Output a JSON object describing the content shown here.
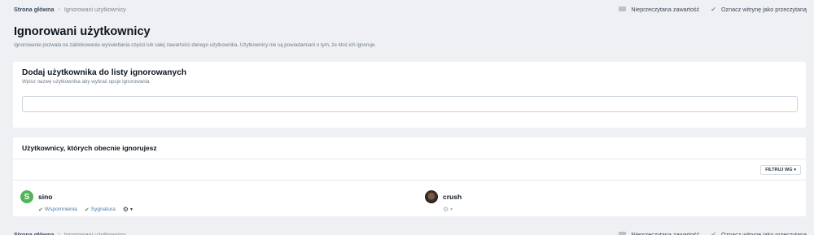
{
  "breadcrumb": {
    "home": "Strona główna",
    "separator": "›",
    "current": "Ignorowani użytkownicy"
  },
  "topbar_actions": {
    "unread": "Nieprzeczytana zawartość",
    "mark_read": "Oznacz witrynę jako przeczytaną"
  },
  "page": {
    "title": "Ignorowani użytkownicy",
    "subtitle": "Ignorowanie pozwala na zablokowanie wyświetlania części lub całej zawartości danego użytkownika. Użytkownicy nie są powiadamiani o tym, że ktoś ich ignoruje."
  },
  "add_card": {
    "heading": "Dodaj użytkownika do listy ignorowanych",
    "hint": "Wpisz nazwę użytkownika aby wybrać opcje ignorowania",
    "input_value": ""
  },
  "list_card": {
    "heading": "Użytkownicy, których obecnie ignorujesz",
    "filter_label": "FILTRUJ WG",
    "users": [
      {
        "initial": "S",
        "name": "sino",
        "options": [
          "Wspomnienia",
          "Sygnatura"
        ]
      },
      {
        "initial": "",
        "name": "crush",
        "options": []
      }
    ]
  },
  "icons": [
    "arrow-sep",
    "unread-icon",
    "check-icon",
    "gear-icon",
    "caret-down-icon"
  ],
  "colors": {
    "avatar_green": "#52b35a",
    "check_green": "#4c9a54",
    "link_blue": "#4a7ea8",
    "background": "#eef0f3"
  }
}
